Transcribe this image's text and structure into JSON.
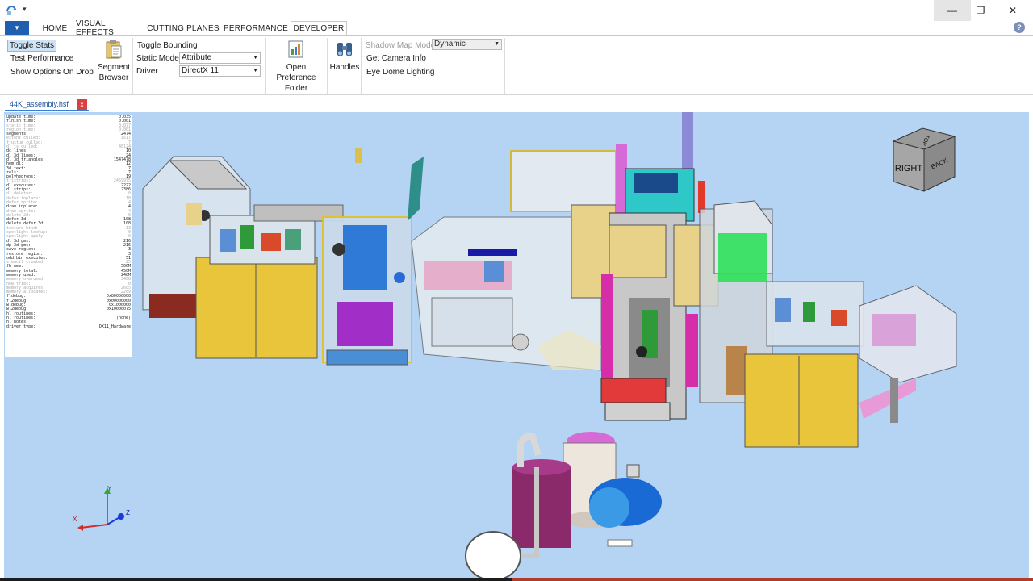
{
  "tabs": {
    "home": "HOME",
    "visual_effects": "VISUAL EFFECTS",
    "cutting_planes": "CUTTING PLANES",
    "performance": "PERFORMANCE",
    "developer": "DEVELOPER"
  },
  "ribbon": {
    "toggle_stats": "Toggle Stats",
    "test_performance": "Test Performance",
    "show_options_on_drop": "Show Options On Drop",
    "segment_browser_1": "Segment",
    "segment_browser_2": "Browser",
    "toggle_bounding": "Toggle Bounding",
    "static_model_label": "Static Model",
    "static_model_value": "Attribute",
    "driver_label": "Driver",
    "driver_value": "DirectX 11",
    "open_pref_1": "Open Preference",
    "open_pref_2": "Folder",
    "handles": "Handles",
    "shadow_map_mode_label": "Shadow Map Mode",
    "shadow_map_mode_value": "Dynamic",
    "get_camera_info": "Get Camera Info",
    "eye_dome_lighting": "Eye Dome Lighting"
  },
  "document": {
    "tab_label": "44K_assembly.hsf",
    "close_glyph": "x"
  },
  "window_controls": {
    "minimize": "—",
    "maximize": "❐",
    "close": "✕"
  },
  "navcube": {
    "right": "RIGHT",
    "back": "BACK",
    "top": "TOP"
  },
  "axes": {
    "x": "X",
    "y": "Y",
    "z": "Z"
  },
  "stats": [
    {
      "label": "update time:",
      "value": "0.035",
      "dim": false
    },
    {
      "label": "finish time:",
      "value": "0.001",
      "dim": false
    },
    {
      "label": "static time:",
      "value": "0.077",
      "dim": true
    },
    {
      "label": "region time:",
      "value": "0.001",
      "dim": true
    },
    {
      "label": "segments:",
      "value": "2474",
      "dim": false
    },
    {
      "label": "extent culled:",
      "value": "1517",
      "dim": true
    },
    {
      "label": "frustum culled:",
      "value": "7",
      "dim": true
    },
    {
      "label": "dl ts culled:",
      "value": "48124",
      "dim": true
    },
    {
      "label": "dc lines:",
      "value": "10",
      "dim": false
    },
    {
      "label": "dl 3d lines:",
      "value": "24",
      "dim": false
    },
    {
      "label": "dl 3d triangles:",
      "value": "1547478",
      "dim": false
    },
    {
      "label": "hem dl:",
      "value": "12",
      "dim": false
    },
    {
      "label": "3d text:",
      "value": "7",
      "dim": false
    },
    {
      "label": "rels:",
      "value": "7",
      "dim": false
    },
    {
      "label": "polyhedrons:",
      "value": "19",
      "dim": false
    },
    {
      "label": "tristrips:",
      "value": "2459975",
      "dim": true
    },
    {
      "label": "dl executes:",
      "value": "2222",
      "dim": false
    },
    {
      "label": "dl strips:",
      "value": "2386",
      "dim": false
    },
    {
      "label": "dl deletes:",
      "value": "0",
      "dim": true
    },
    {
      "label": "defer inplace:",
      "value": "10",
      "dim": true
    },
    {
      "label": "defer sprite:",
      "value": "4",
      "dim": true
    },
    {
      "label": "draw inplace:",
      "value": "4",
      "dim": false
    },
    {
      "label": "draw sprite:",
      "value": "4",
      "dim": true
    },
    {
      "label": "delete 2d:",
      "value": "0",
      "dim": true
    },
    {
      "label": "defer 3d:",
      "value": "108",
      "dim": false
    },
    {
      "label": "delete defer 3d:",
      "value": "108",
      "dim": false
    },
    {
      "label": "texture bind:",
      "value": "13",
      "dim": true
    },
    {
      "label": "spotlight lookup:",
      "value": "0",
      "dim": true
    },
    {
      "label": "spotlight apply:",
      "value": "0",
      "dim": true
    },
    {
      "label": "dl 3d gms:",
      "value": "216",
      "dim": false
    },
    {
      "label": "dp 3d gms:",
      "value": "216",
      "dim": false
    },
    {
      "label": "save region:",
      "value": "3",
      "dim": false
    },
    {
      "label": "restore region:",
      "value": "3",
      "dim": false
    },
    {
      "label": "odd bin executes:",
      "value": "51",
      "dim": false
    },
    {
      "label": "stencil created:",
      "value": "25",
      "dim": true
    },
    {
      "label": "fb mem:",
      "value": "506M",
      "dim": false
    },
    {
      "label": "memory total:",
      "value": "450M",
      "dim": false
    },
    {
      "label": "memory used:",
      "value": "248M",
      "dim": false
    },
    {
      "label": "memory overused:",
      "value": "3468",
      "dim": true
    },
    {
      "label": "new tries:",
      "value": "0",
      "dim": true
    },
    {
      "label": "memory acquires:",
      "value": "2605",
      "dim": true
    },
    {
      "label": "memory allocates:",
      "value": "2269",
      "dim": true
    },
    {
      "label": "fldebug:",
      "value": "0x80000000",
      "dim": false
    },
    {
      "label": "fl2debug:",
      "value": "0x00000000",
      "dim": false
    },
    {
      "label": "wldebug:",
      "value": "0x1000000",
      "dim": false
    },
    {
      "label": "wl2debug:",
      "value": "0x10000075",
      "dim": false
    },
    {
      "label": "hl_routines:",
      "value": "",
      "dim": false
    },
    {
      "label": "hl_routines:",
      "value": "(none)",
      "dim": false
    },
    {
      "label": "hl_notes:",
      "value": "",
      "dim": false
    },
    {
      "label": "driver type:",
      "value": "DX11_Hardware",
      "dim": false
    }
  ],
  "colors": {
    "viewport_bg": "#b5d3f2",
    "accent_blue": "#1f5fb0",
    "tab_highlight": "#cfe3f7",
    "close_red": "#d94040"
  }
}
